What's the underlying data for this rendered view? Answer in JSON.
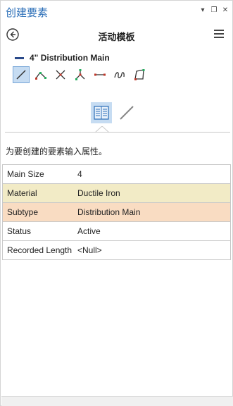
{
  "pane": {
    "title": "创建要素",
    "pin_glyph": "▾",
    "restore_glyph": "❐",
    "close_glyph": "✕"
  },
  "header": {
    "title": "活动模板",
    "back_icon": "back-arrow-icon",
    "menu_icon": "hamburger-menu-icon"
  },
  "template": {
    "name": "4\" Distribution Main",
    "swatch_color": "#2a4a8a"
  },
  "tools": [
    {
      "name": "line-tool",
      "active": true
    },
    {
      "name": "polyline-tool",
      "active": false
    },
    {
      "name": "cross-tool",
      "active": false
    },
    {
      "name": "vertices-tool",
      "active": false
    },
    {
      "name": "segment-tool",
      "active": false
    },
    {
      "name": "freehand-tool",
      "active": false
    },
    {
      "name": "polygon-tool",
      "active": false
    }
  ],
  "view_tabs": [
    {
      "name": "attributes-tab",
      "active": true
    },
    {
      "name": "geometry-tab",
      "active": false
    }
  ],
  "instruction": "为要创建的要素输入属性。",
  "attributes": [
    {
      "key": "Main Size",
      "value": "4",
      "bg": "#ffffff"
    },
    {
      "key": "Material",
      "value": "Ductile Iron",
      "bg": "#f2ebc6"
    },
    {
      "key": "Subtype",
      "value": "Distribution Main",
      "bg": "#f9dcc2"
    },
    {
      "key": "Status",
      "value": "Active",
      "bg": "#ffffff"
    },
    {
      "key": "Recorded Length",
      "value": "<Null>",
      "bg": "#ffffff"
    }
  ],
  "colors": {
    "accent": "#2c6fb8",
    "active_bg": "#c6dcf2"
  }
}
